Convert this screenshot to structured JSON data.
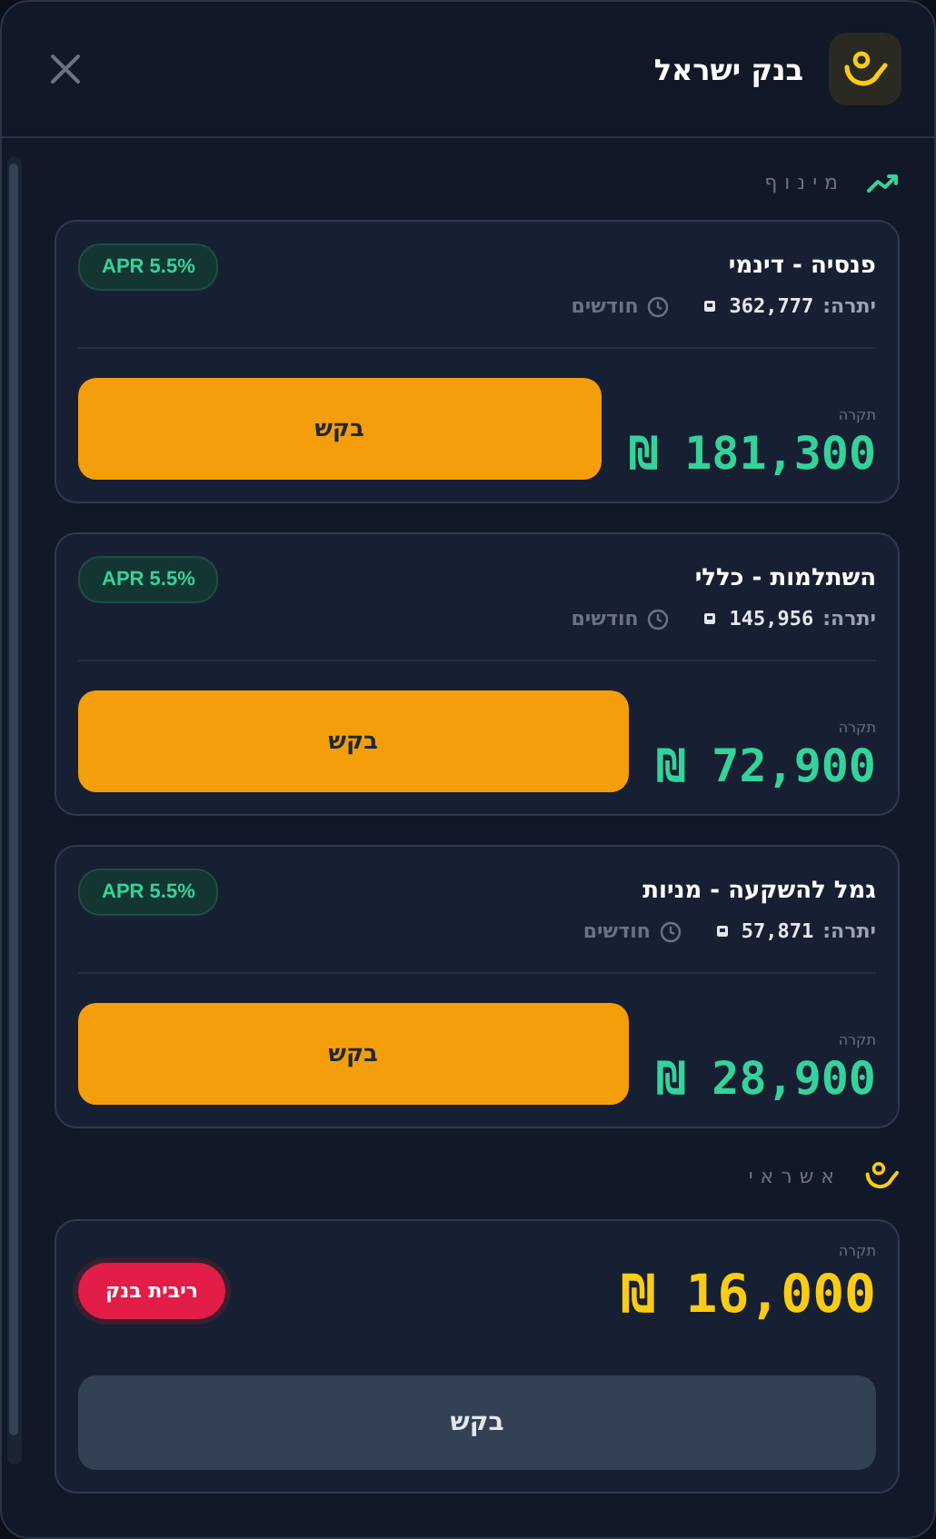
{
  "header": {
    "title": "בנק ישראל"
  },
  "sections": [
    {
      "kind": "loans",
      "title": "מינוף",
      "items": [
        {
          "name": "פנסיה - דינמי",
          "balance_label": "יתרה:",
          "balance": "362,777",
          "term": "חודשים",
          "apr": "APR 5.5%",
          "ceiling_label": "תקרה",
          "amount": "₪ 181,300",
          "button": "בקש"
        },
        {
          "name": "השתלמות - כללי",
          "balance_label": "יתרה:",
          "balance": "145,956",
          "term": "חודשים",
          "apr": "APR 5.5%",
          "ceiling_label": "תקרה",
          "amount": "₪ 72,900",
          "button": "בקש"
        },
        {
          "name": "גמל להשקעה - מניות",
          "balance_label": "יתרה:",
          "balance": "57,871",
          "term": "חודשים",
          "apr": "APR 5.5%",
          "ceiling_label": "תקרה",
          "amount": "₪ 28,900",
          "button": "בקש"
        }
      ]
    },
    {
      "kind": "credit",
      "title": "אשראי",
      "items": [
        {
          "badge": "ריבית בנק",
          "ceiling_label": "תקרה",
          "amount": "₪ 16,000",
          "button": "בקש"
        }
      ]
    }
  ]
}
